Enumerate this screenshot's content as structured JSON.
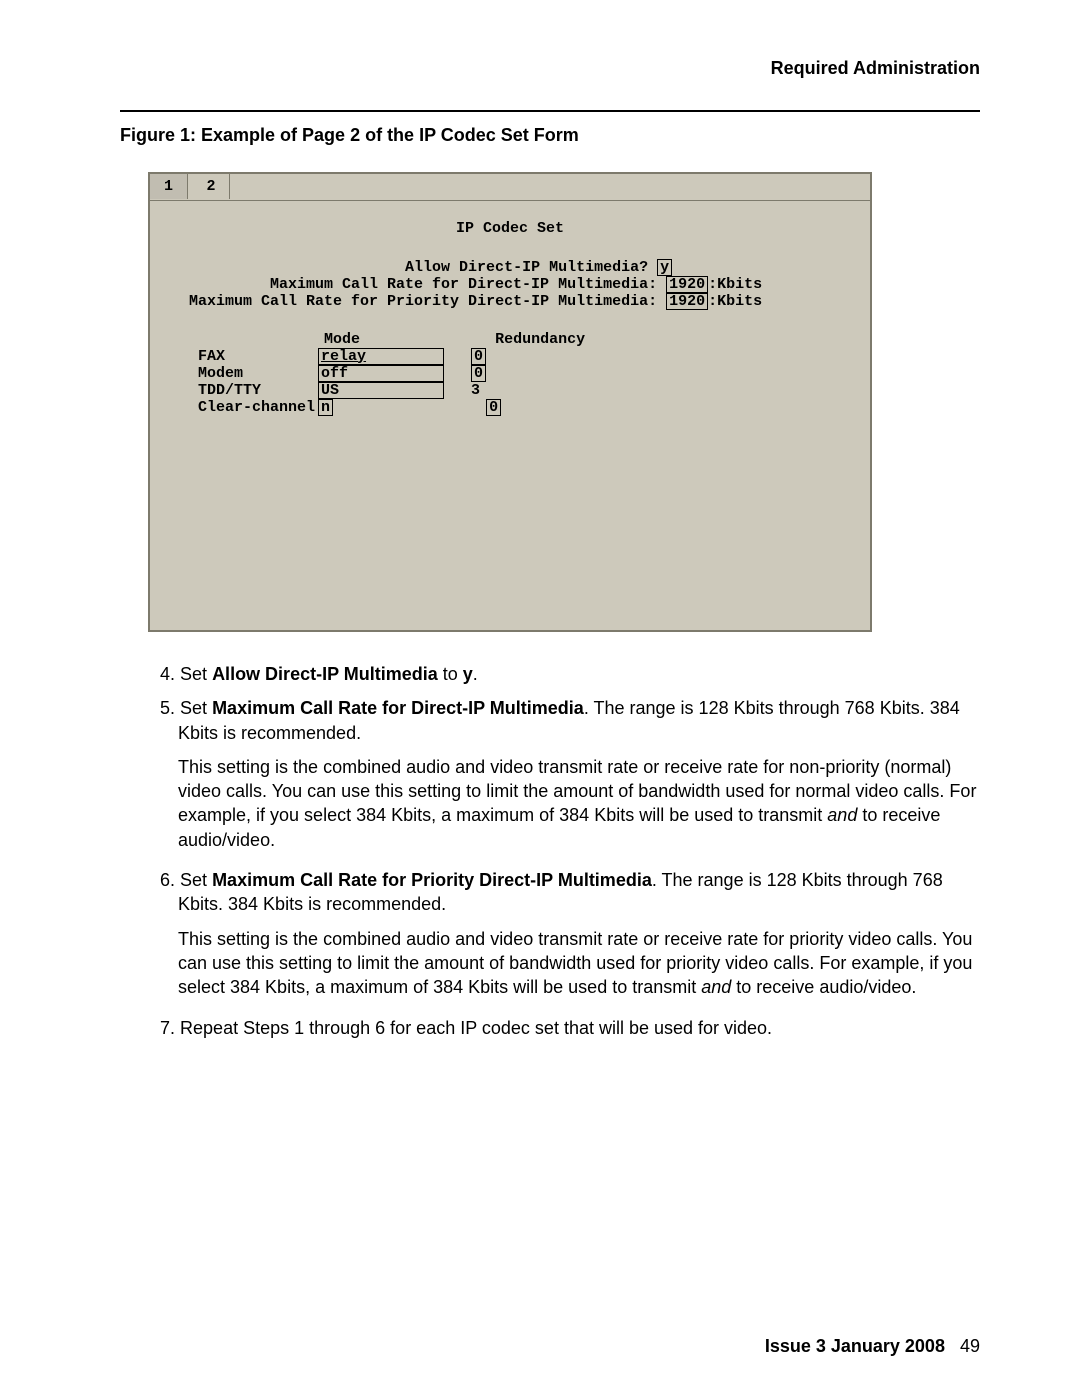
{
  "header": {
    "section": "Required Administration"
  },
  "figure": {
    "caption": "Figure 1: Example of Page 2 of the IP Codec Set Form"
  },
  "terminal": {
    "tabs": [
      "1",
      "2"
    ],
    "active_tab": 1,
    "title": "IP Codec Set",
    "allow_label": "Allow Direct-IP Multimedia?",
    "allow_value": "y",
    "rate1_label": "Maximum Call Rate for Direct-IP Multimedia:",
    "rate1_value": "1920",
    "rate1_unit": ":Kbits",
    "rate2_label": "Maximum Call Rate for Priority Direct-IP Multimedia:",
    "rate2_value": "1920",
    "rate2_unit": ":Kbits",
    "col_mode": "Mode",
    "col_red": "Redundancy",
    "rows": [
      {
        "label": "FAX",
        "mode": "relay",
        "red": "0"
      },
      {
        "label": "Modem",
        "mode": "off",
        "red": "0"
      },
      {
        "label": "TDD/TTY",
        "mode": "US",
        "red": "3"
      },
      {
        "label": "Clear-channel",
        "mode": "n",
        "red": "0"
      }
    ]
  },
  "steps": {
    "s4_num": "4.",
    "s4_a": "Set ",
    "s4_b": "Allow Direct-IP Multimedia",
    "s4_c": " to ",
    "s4_d": "y",
    "s4_e": ".",
    "s5_num": "5.",
    "s5_a": "Set ",
    "s5_b": "Maximum Call Rate for Direct-IP Multimedia",
    "s5_c": ". The range is 128 Kbits through 768 Kbits. 384 Kbits is recommended.",
    "s5_p1": "This setting is the combined audio and video transmit rate or receive rate for non-priority (normal) video calls. You can use this setting to limit the amount of bandwidth used for normal video calls. For example, if you select 384 Kbits, a maximum of 384 Kbits will be used to transmit ",
    "s5_p1_i": "and",
    "s5_p1b": " to receive audio/video.",
    "s6_num": "6.",
    "s6_a": "Set ",
    "s6_b": "Maximum Call Rate for Priority Direct-IP Multimedia",
    "s6_c": ". The range is 128 Kbits through 768 Kbits. 384 Kbits is recommended.",
    "s6_p1": "This setting is the combined audio and video transmit rate or receive rate for priority video calls. You can use this setting to limit the amount of bandwidth used for priority video calls. For example, if you select 384 Kbits, a maximum of 384 Kbits will be used to transmit ",
    "s6_p1_i": "and",
    "s6_p1b": " to receive audio/video.",
    "s7_num": "7.",
    "s7": "Repeat Steps 1 through 6 for each IP codec set that will be used for video."
  },
  "footer": {
    "issue": "Issue 3   January 2008",
    "page": "49"
  }
}
